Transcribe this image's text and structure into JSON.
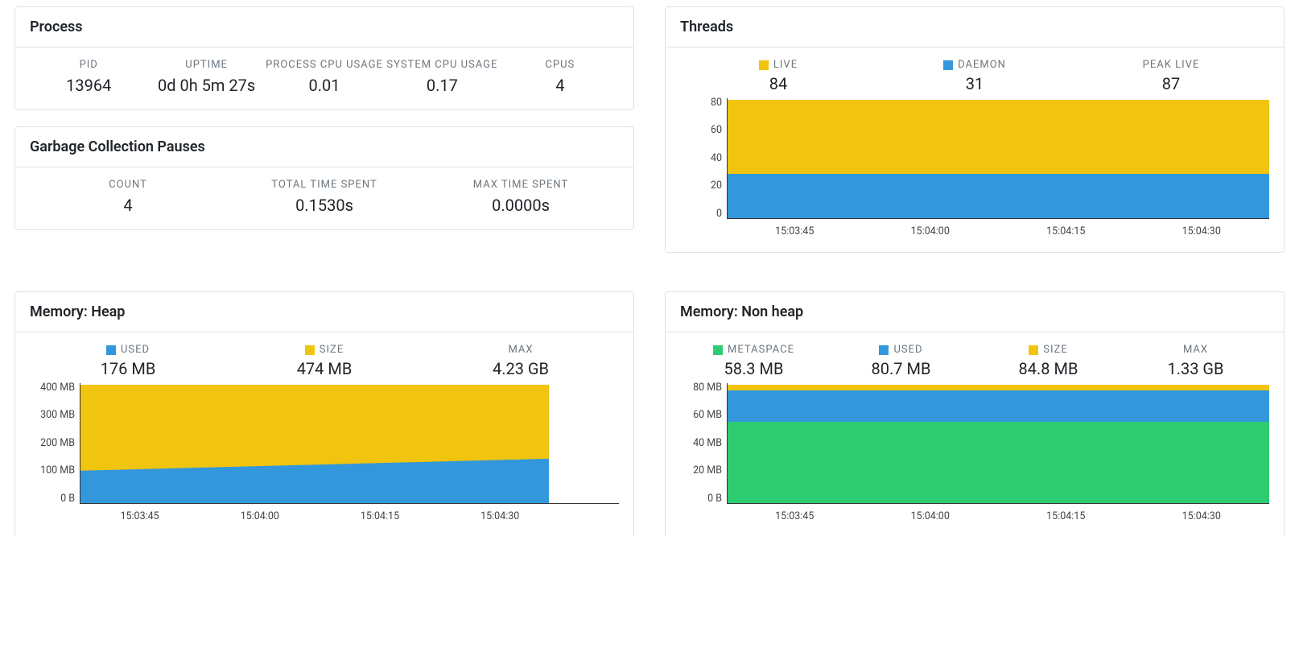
{
  "colors": {
    "blue": "#3398db",
    "yellow": "#f1c40f",
    "green": "#2ecc71"
  },
  "process": {
    "title": "Process",
    "stats": {
      "pid": {
        "label": "PID",
        "value": "13964"
      },
      "uptime": {
        "label": "UPTIME",
        "value": "0d 0h 5m 27s"
      },
      "pcpu": {
        "label": "PROCESS CPU USAGE",
        "value": "0.01"
      },
      "scpu": {
        "label": "SYSTEM CPU USAGE",
        "value": "0.17"
      },
      "cpus": {
        "label": "CPUS",
        "value": "4"
      }
    }
  },
  "gc": {
    "title": "Garbage Collection Pauses",
    "stats": {
      "count": {
        "label": "COUNT",
        "value": "4"
      },
      "total": {
        "label": "TOTAL TIME SPENT",
        "value": "0.1530s"
      },
      "max": {
        "label": "MAX TIME SPENT",
        "value": "0.0000s"
      }
    }
  },
  "threads": {
    "title": "Threads",
    "legend": {
      "live": {
        "label": "LIVE",
        "value": "84"
      },
      "daemon": {
        "label": "DAEMON",
        "value": "31"
      },
      "peak": {
        "label": "PEAK LIVE",
        "value": "87"
      }
    },
    "yticks": [
      "80",
      "60",
      "40",
      "20",
      "0"
    ],
    "xticks": [
      "15:03:45",
      "15:04:00",
      "15:04:15",
      "15:04:30"
    ]
  },
  "heap": {
    "title": "Memory: Heap",
    "legend": {
      "used": {
        "label": "USED",
        "value": "176 MB"
      },
      "size": {
        "label": "SIZE",
        "value": "474 MB"
      },
      "max": {
        "label": "MAX",
        "value": "4.23 GB"
      }
    },
    "yticks": [
      "400 MB",
      "300 MB",
      "200 MB",
      "100 MB",
      "0 B"
    ],
    "xticks": [
      "15:03:45",
      "15:04:00",
      "15:04:15",
      "15:04:30"
    ]
  },
  "nonheap": {
    "title": "Memory: Non heap",
    "legend": {
      "metaspace": {
        "label": "METASPACE",
        "value": "58.3 MB"
      },
      "used": {
        "label": "USED",
        "value": "80.7 MB"
      },
      "size": {
        "label": "SIZE",
        "value": "84.8 MB"
      },
      "max": {
        "label": "MAX",
        "value": "1.33 GB"
      }
    },
    "yticks": [
      "80 MB",
      "60 MB",
      "40 MB",
      "20 MB",
      "0 B"
    ],
    "xticks": [
      "15:03:45",
      "15:04:00",
      "15:04:15",
      "15:04:30"
    ]
  },
  "chart_data": [
    {
      "type": "area",
      "title": "Threads",
      "xlabel": "",
      "ylabel": "",
      "ylim": [
        0,
        85
      ],
      "x": [
        "15:03:45",
        "15:04:00",
        "15:04:15",
        "15:04:30"
      ],
      "series": [
        {
          "name": "LIVE",
          "color": "#f1c40f",
          "values": [
            84,
            84,
            84,
            84
          ]
        },
        {
          "name": "DAEMON",
          "color": "#3398db",
          "values": [
            31,
            31,
            31,
            31
          ]
        }
      ],
      "summary": {
        "LIVE": 84,
        "DAEMON": 31,
        "PEAK LIVE": 87
      }
    },
    {
      "type": "area",
      "title": "Memory: Heap",
      "xlabel": "",
      "ylabel": "",
      "ylim": [
        0,
        480
      ],
      "unit": "MB",
      "x": [
        "15:03:45",
        "15:04:00",
        "15:04:15",
        "15:04:30"
      ],
      "series": [
        {
          "name": "SIZE",
          "color": "#f1c40f",
          "values": [
            474,
            474,
            474,
            474
          ]
        },
        {
          "name": "USED",
          "color": "#3398db",
          "values": [
            128,
            145,
            160,
            176
          ]
        }
      ],
      "summary": {
        "USED": "176 MB",
        "SIZE": "474 MB",
        "MAX": "4.23 GB"
      }
    },
    {
      "type": "area",
      "title": "Memory: Non heap",
      "xlabel": "",
      "ylabel": "",
      "ylim": [
        0,
        86
      ],
      "unit": "MB",
      "x": [
        "15:03:45",
        "15:04:00",
        "15:04:15",
        "15:04:30"
      ],
      "series": [
        {
          "name": "SIZE",
          "color": "#f1c40f",
          "values": [
            84.8,
            84.8,
            84.8,
            84.8
          ]
        },
        {
          "name": "USED",
          "color": "#3398db",
          "values": [
            80.7,
            80.7,
            80.7,
            80.7
          ]
        },
        {
          "name": "METASPACE",
          "color": "#2ecc71",
          "values": [
            58.3,
            58.3,
            58.3,
            58.3
          ]
        }
      ],
      "summary": {
        "METASPACE": "58.3 MB",
        "USED": "80.7 MB",
        "SIZE": "84.8 MB",
        "MAX": "1.33 GB"
      }
    }
  ]
}
